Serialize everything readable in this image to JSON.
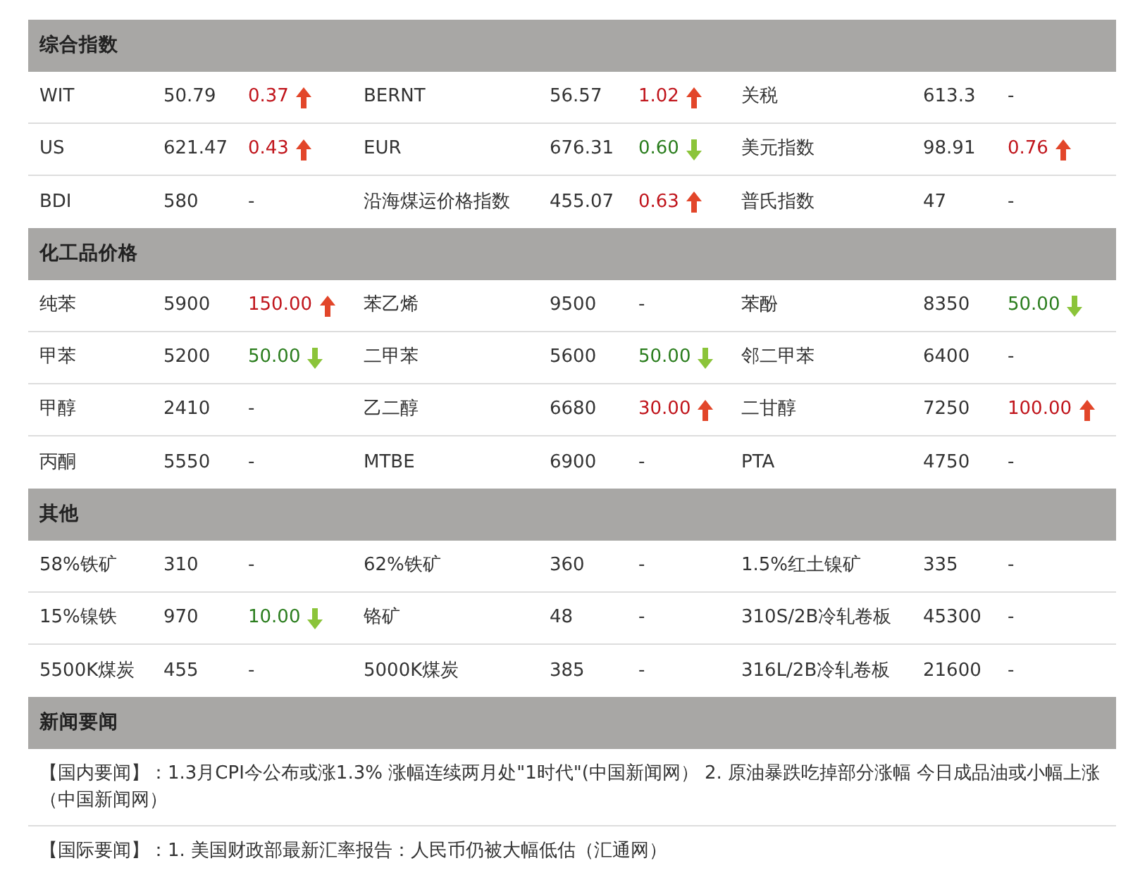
{
  "sections": [
    {
      "title": "综合指数",
      "rows": [
        [
          {
            "name": "WIT",
            "value": "50.79",
            "change": "0.37",
            "kind": "up"
          },
          {
            "name": "BERNT",
            "value": "56.57",
            "change": "1.02",
            "kind": "up"
          },
          {
            "name": "关税",
            "value": "613.3",
            "change": "-",
            "kind": "flat"
          }
        ],
        [
          {
            "name": "US",
            "value": "621.47",
            "change": "0.43",
            "kind": "up"
          },
          {
            "name": "EUR",
            "value": "676.31",
            "change": "0.60",
            "kind": "down"
          },
          {
            "name": "美元指数",
            "value": "98.91",
            "change": "0.76",
            "kind": "up"
          }
        ],
        [
          {
            "name": "BDI",
            "value": "580",
            "change": "-",
            "kind": "flat"
          },
          {
            "name": "沿海煤运价格指数",
            "value": "455.07",
            "change": "0.63",
            "kind": "up"
          },
          {
            "name": "普氏指数",
            "value": "47",
            "change": "-",
            "kind": "flat"
          }
        ]
      ]
    },
    {
      "title": "化工品价格",
      "rows": [
        [
          {
            "name": "纯苯",
            "value": "5900",
            "change": "150.00",
            "kind": "up"
          },
          {
            "name": "苯乙烯",
            "value": "9500",
            "change": "-",
            "kind": "flat"
          },
          {
            "name": "苯酚",
            "value": "8350",
            "change": "50.00",
            "kind": "down"
          }
        ],
        [
          {
            "name": "甲苯",
            "value": "5200",
            "change": "50.00",
            "kind": "down"
          },
          {
            "name": "二甲苯",
            "value": "5600",
            "change": "50.00",
            "kind": "down"
          },
          {
            "name": "邻二甲苯",
            "value": "6400",
            "change": "-",
            "kind": "flat"
          }
        ],
        [
          {
            "name": "甲醇",
            "value": "2410",
            "change": "-",
            "kind": "flat"
          },
          {
            "name": "乙二醇",
            "value": "6680",
            "change": "30.00",
            "kind": "up"
          },
          {
            "name": "二甘醇",
            "value": "7250",
            "change": "100.00",
            "kind": "up"
          }
        ],
        [
          {
            "name": "丙酮",
            "value": "5550",
            "change": "-",
            "kind": "flat"
          },
          {
            "name": "MTBE",
            "value": "6900",
            "change": "-",
            "kind": "flat"
          },
          {
            "name": "PTA",
            "value": "4750",
            "change": "-",
            "kind": "flat"
          }
        ]
      ]
    },
    {
      "title": "其他",
      "rows": [
        [
          {
            "name": "58%铁矿",
            "value": "310",
            "change": "-",
            "kind": "flat"
          },
          {
            "name": "62%铁矿",
            "value": "360",
            "change": "-",
            "kind": "flat"
          },
          {
            "name": "1.5%红土镍矿",
            "value": "335",
            "change": "-",
            "kind": "flat"
          }
        ],
        [
          {
            "name": "15%镍铁",
            "value": "970",
            "change": "10.00",
            "kind": "down"
          },
          {
            "name": "铬矿",
            "value": "48",
            "change": "-",
            "kind": "flat"
          },
          {
            "name": "310S/2B冷轧卷板",
            "value": "45300",
            "change": "-",
            "kind": "flat"
          }
        ],
        [
          {
            "name": "5500K煤炭",
            "value": "455",
            "change": "-",
            "kind": "flat"
          },
          {
            "name": "5000K煤炭",
            "value": "385",
            "change": "-",
            "kind": "flat"
          },
          {
            "name": "316L/2B冷轧卷板",
            "value": "21600",
            "change": "-",
            "kind": "flat"
          }
        ]
      ]
    }
  ],
  "news": {
    "title": "新闻要闻",
    "items": [
      "【国内要闻】：1.3月CPI今公布或涨1.3% 涨幅连续两月处\"1时代\"(中国新闻网） 2. 原油暴跌吃掉部分涨幅 今日成品油或小幅上涨（中国新闻网）",
      "【国际要闻】：1. 美国财政部最新汇率报告：人民币仍被大幅低估（汇通网）"
    ]
  }
}
